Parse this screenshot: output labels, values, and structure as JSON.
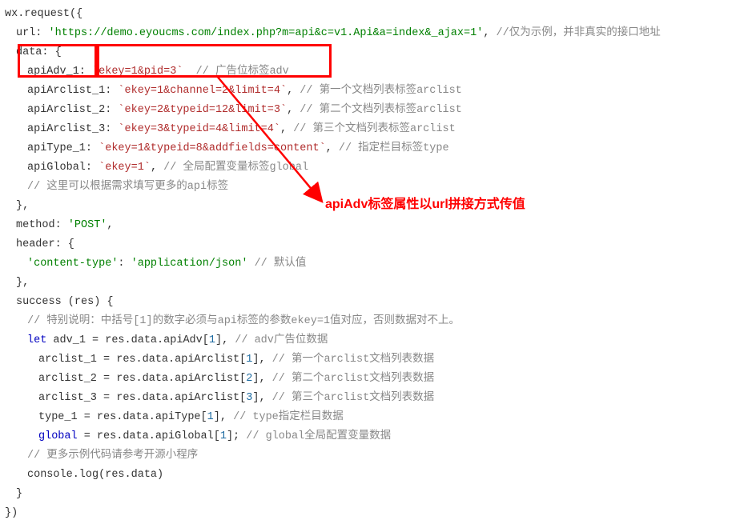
{
  "code": {
    "l01": "wx.request({",
    "l02_a": "url: ",
    "l02_b": "'https://demo.eyoucms.com/index.php?m=api&c=v1.Api&a=index&_ajax=1'",
    "l02_c": ", ",
    "l02_d": "//仅为示例，并非真实的接口地址",
    "l03": "data: {",
    "l04_a": "apiAdv_1: ",
    "l04_b": "`ekey=1&pid=3`",
    "l04_c": "  ",
    "l04_d": "// 广告位标签adv",
    "l05_a": "apiArclist_1: ",
    "l05_b": "`ekey=1&channel=2&limit=4`",
    "l05_c": ", ",
    "l05_d": "// 第一个文档列表标签arclist",
    "l06_a": "apiArclist_2: ",
    "l06_b": "`ekey=2&typeid=12&limit=3`",
    "l06_c": ", ",
    "l06_d": "// 第二个文档列表标签arclist",
    "l07_a": "apiArclist_3: ",
    "l07_b": "`ekey=3&typeid=4&limit=4`",
    "l07_c": ", ",
    "l07_d": "// 第三个文档列表标签arclist",
    "l08_a": "apiType_1: ",
    "l08_b": "`ekey=1&typeid=8&addfields=content`",
    "l08_c": ", ",
    "l08_d": "// 指定栏目标签type",
    "l09_a": "apiGlobal: ",
    "l09_b": "`ekey=1`",
    "l09_c": ", ",
    "l09_d": "// 全局配置变量标签global",
    "l10": "// 这里可以根据需求填写更多的api标签",
    "l11": "},",
    "l12_a": "method: ",
    "l12_b": "'POST'",
    "l12_c": ",",
    "l13": "header: {",
    "l14_a": "'content-type'",
    "l14_b": ": ",
    "l14_c": "'application/json'",
    "l14_d": " ",
    "l14_e": "// 默认值",
    "l15": "},",
    "l16": "success (res) {",
    "l17": "// 特别说明：中括号[1]的数字必须与api标签的参数ekey=1值对应，否则数据对不上。",
    "l18_a": "let",
    "l18_b": " adv_1 = res.data.apiAdv[",
    "l18_c": "1",
    "l18_d": "], ",
    "l18_e": "// adv广告位数据",
    "l19_a": "arclist_1 = res.data.apiArclist[",
    "l19_b": "1",
    "l19_c": "], ",
    "l19_d": "// 第一个arclist文档列表数据",
    "l20_a": "arclist_2 = res.data.apiArclist[",
    "l20_b": "2",
    "l20_c": "], ",
    "l20_d": "// 第二个arclist文档列表数据",
    "l21_a": "arclist_3 = res.data.apiArclist[",
    "l21_b": "3",
    "l21_c": "], ",
    "l21_d": "// 第三个arclist文档列表数据",
    "l22_a": "type_1 = res.data.apiType[",
    "l22_b": "1",
    "l22_c": "], ",
    "l22_d": "// type指定栏目数据",
    "l23_a": "global",
    "l23_b": " = res.data.apiGlobal[",
    "l23_c": "1",
    "l23_d": "]; ",
    "l23_e": "// global全局配置变量数据",
    "l24": "// 更多示例代码请参考开源小程序",
    "l25": "console.log(res.data)",
    "l26": "}",
    "l27": "})"
  },
  "annotation": "apiAdv标签属性以url拼接方式传值"
}
